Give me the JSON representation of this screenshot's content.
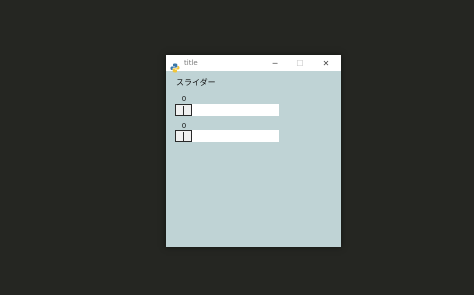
{
  "window": {
    "title": "title",
    "controls": {
      "minimize": "─",
      "maximize": "☐",
      "close": "✕"
    }
  },
  "content": {
    "heading": "スライダー",
    "sliders": [
      {
        "value": "0",
        "level": 0
      },
      {
        "value": "0",
        "level": 0
      }
    ]
  },
  "colors": {
    "desktop": "#252622",
    "window_bg": "#bfd3d5",
    "titlebar": "#ffffff",
    "track": "#ffffff"
  },
  "icons": {
    "app": "python-icon"
  }
}
